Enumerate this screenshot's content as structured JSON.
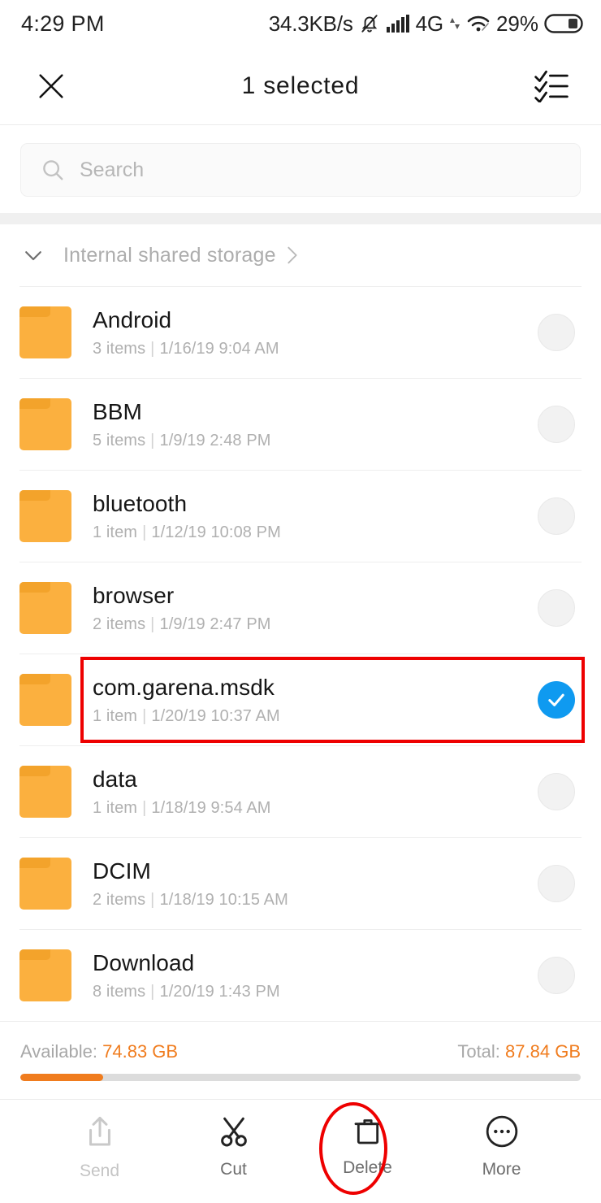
{
  "status_bar": {
    "time": "4:29 PM",
    "network_speed": "34.3KB/s",
    "mute_icon": "bell-muted-icon",
    "signal_icon": "signal-bars-icon",
    "network_type": "4G",
    "data_arrows_icon": "data-transfer-icon",
    "wifi_icon": "wifi-icon",
    "battery_percent": "29%",
    "battery_icon": "battery-icon"
  },
  "header": {
    "close_icon": "close-icon",
    "title": "1 selected",
    "select_all_icon": "select-all-checklist-icon"
  },
  "search": {
    "icon": "search-icon",
    "placeholder": "Search"
  },
  "breadcrumb": {
    "collapse_icon": "chevron-down-icon",
    "path_label": "Internal shared storage",
    "chevron_icon": "chevron-right-icon"
  },
  "files": [
    {
      "name": "Android",
      "items": "3 items",
      "separator": "|",
      "date": "1/16/19 9:04 AM",
      "selected": false,
      "icon": "folder-icon"
    },
    {
      "name": "BBM",
      "items": "5 items",
      "separator": "|",
      "date": "1/9/19 2:48 PM",
      "selected": false,
      "icon": "folder-icon"
    },
    {
      "name": "bluetooth",
      "items": "1 item",
      "separator": "|",
      "date": "1/12/19 10:08 PM",
      "selected": false,
      "icon": "folder-icon"
    },
    {
      "name": "browser",
      "items": "2 items",
      "separator": "|",
      "date": "1/9/19 2:47 PM",
      "selected": false,
      "icon": "folder-icon"
    },
    {
      "name": "com.garena.msdk",
      "items": "1 item",
      "separator": "|",
      "date": "1/20/19 10:37 AM",
      "selected": true,
      "icon": "folder-icon"
    },
    {
      "name": "data",
      "items": "1 item",
      "separator": "|",
      "date": "1/18/19 9:54 AM",
      "selected": false,
      "icon": "folder-icon"
    },
    {
      "name": "DCIM",
      "items": "2 items",
      "separator": "|",
      "date": "1/18/19 10:15 AM",
      "selected": false,
      "icon": "folder-icon"
    },
    {
      "name": "Download",
      "items": "8 items",
      "separator": "|",
      "date": "1/20/19 1:43 PM",
      "selected": false,
      "icon": "folder-icon"
    }
  ],
  "storage": {
    "available_label": "Available:",
    "available_value": "74.83 GB",
    "total_label": "Total:",
    "total_value": "87.84 GB",
    "used_percent": 14.8
  },
  "bottom_bar": [
    {
      "label": "Send",
      "icon": "share-upload-icon",
      "disabled": true
    },
    {
      "label": "Cut",
      "icon": "scissors-icon",
      "disabled": false
    },
    {
      "label": "Delete",
      "icon": "trash-icon",
      "disabled": false
    },
    {
      "label": "More",
      "icon": "more-ellipsis-icon",
      "disabled": false
    }
  ],
  "annotations": {
    "highlight_color": "#ee0000",
    "selected_row_box": true,
    "delete_button_ellipse": true
  },
  "colors": {
    "folder": "#fbb03f",
    "checkbox_checked": "#0f9af0",
    "storage_accent": "#f07c1e",
    "annotation_red": "#ee0000"
  }
}
